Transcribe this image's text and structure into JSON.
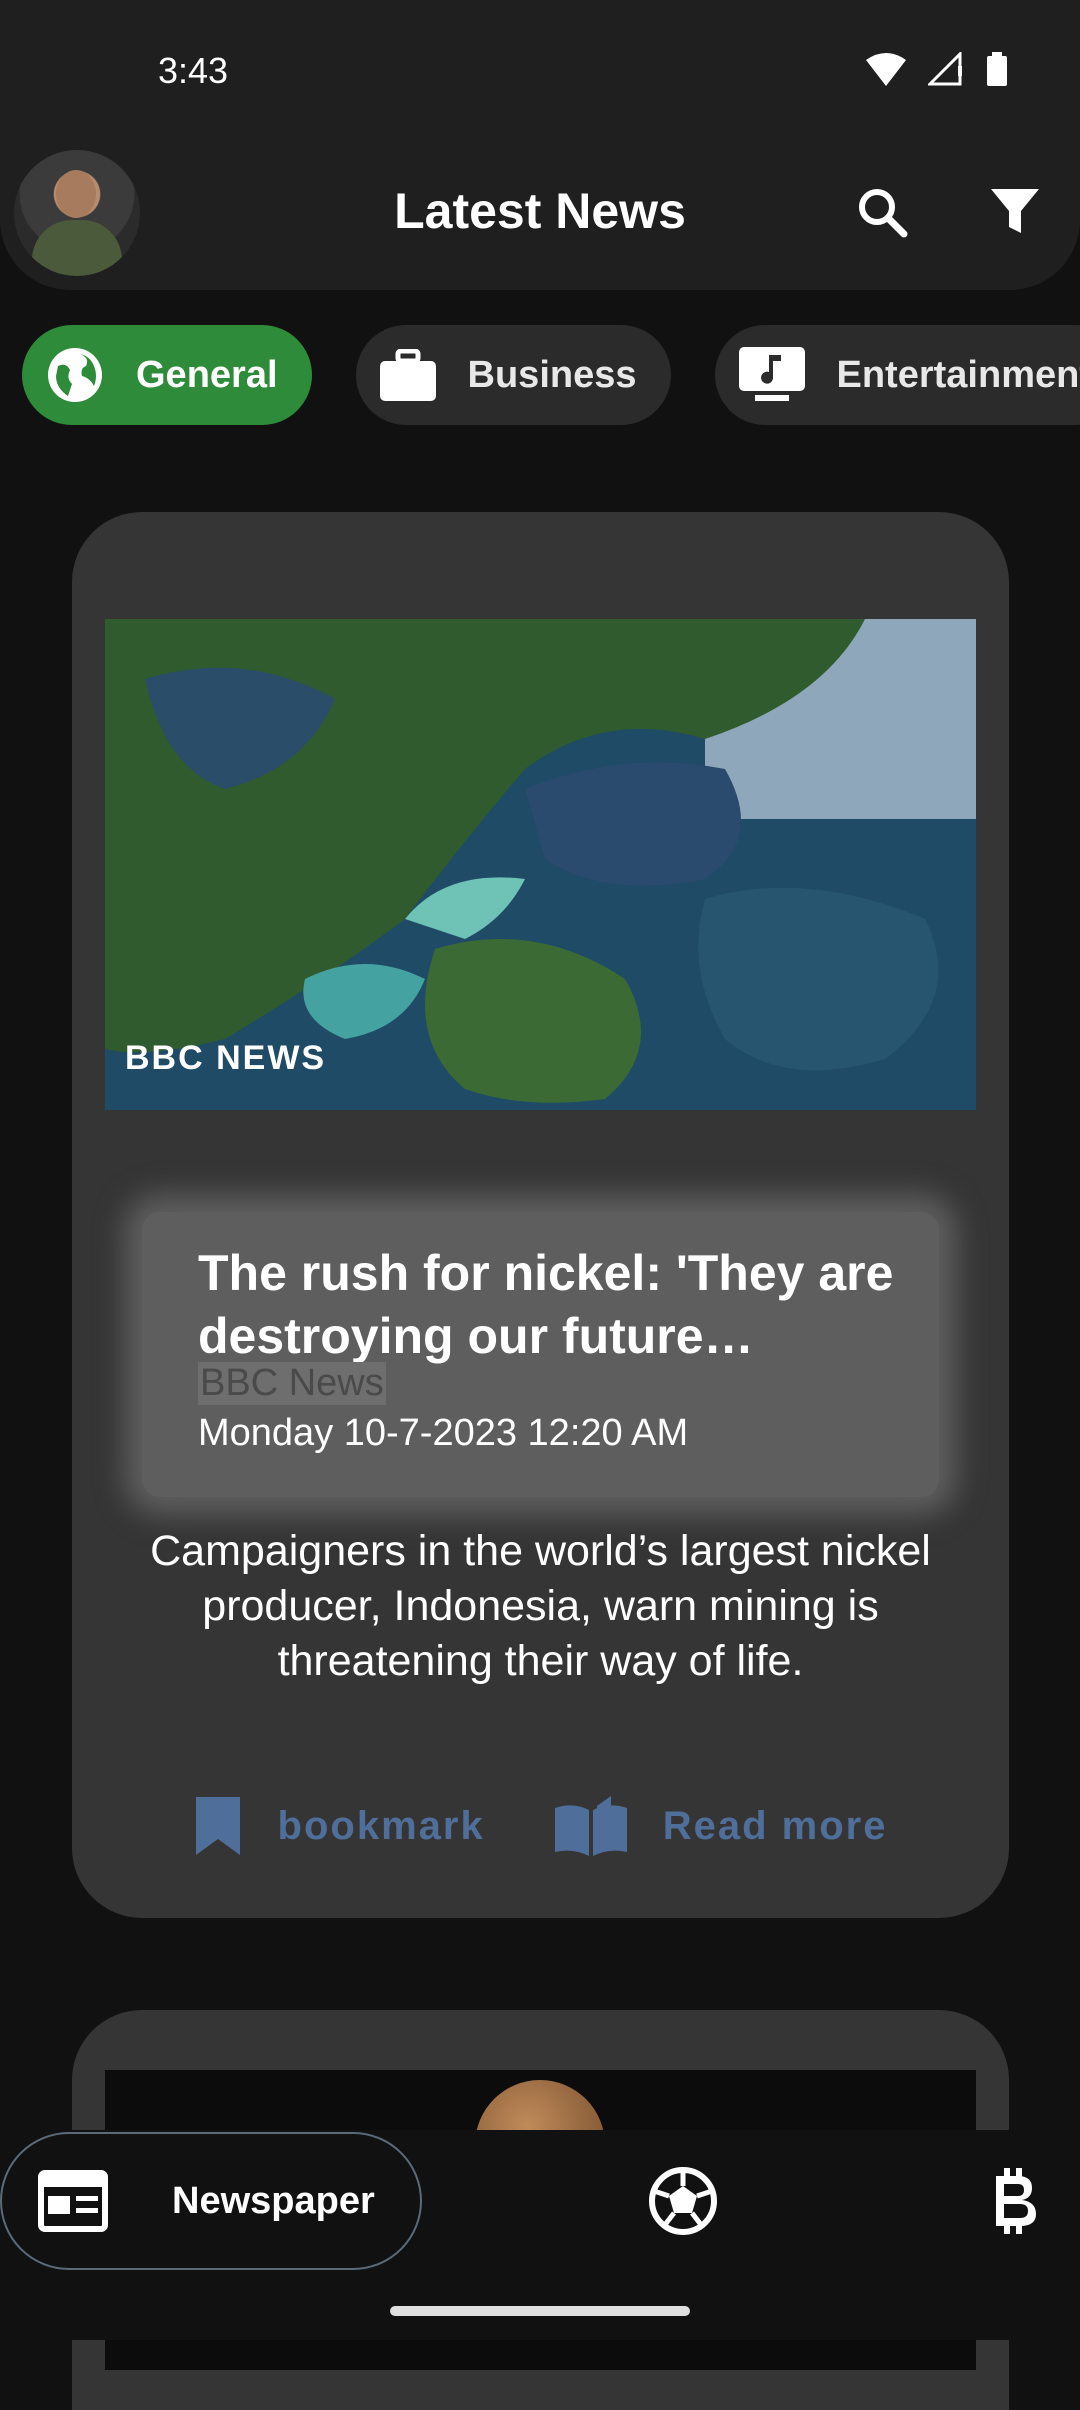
{
  "status_bar": {
    "time": "3:43"
  },
  "header": {
    "title": "Latest News"
  },
  "categories": [
    {
      "label": "General",
      "active": true,
      "icon": "globe-icon"
    },
    {
      "label": "Business",
      "active": false,
      "icon": "briefcase-icon"
    },
    {
      "label": "Entertainment",
      "active": false,
      "icon": "music-monitor-icon"
    }
  ],
  "article": {
    "image_watermark": "BBC NEWS",
    "title": "The rush for nickel: 'They are destroying our future…",
    "source": "BBC News",
    "date": "Monday 10-7-2023  12:20 AM",
    "description": "Campaigners in the world’s largest nickel producer, Indonesia, warn mining is threatening their way of life.",
    "bookmark_label": "bookmark",
    "read_more_label": "Read more"
  },
  "bottom_nav": {
    "active_label": "Newspaper",
    "items": [
      "newspaper-icon",
      "soccer-ball-icon",
      "bitcoin-icon"
    ]
  },
  "colors": {
    "accent_green": "#2e8b39",
    "action_blue": "#4f6f9a",
    "card_bg": "#353535"
  }
}
